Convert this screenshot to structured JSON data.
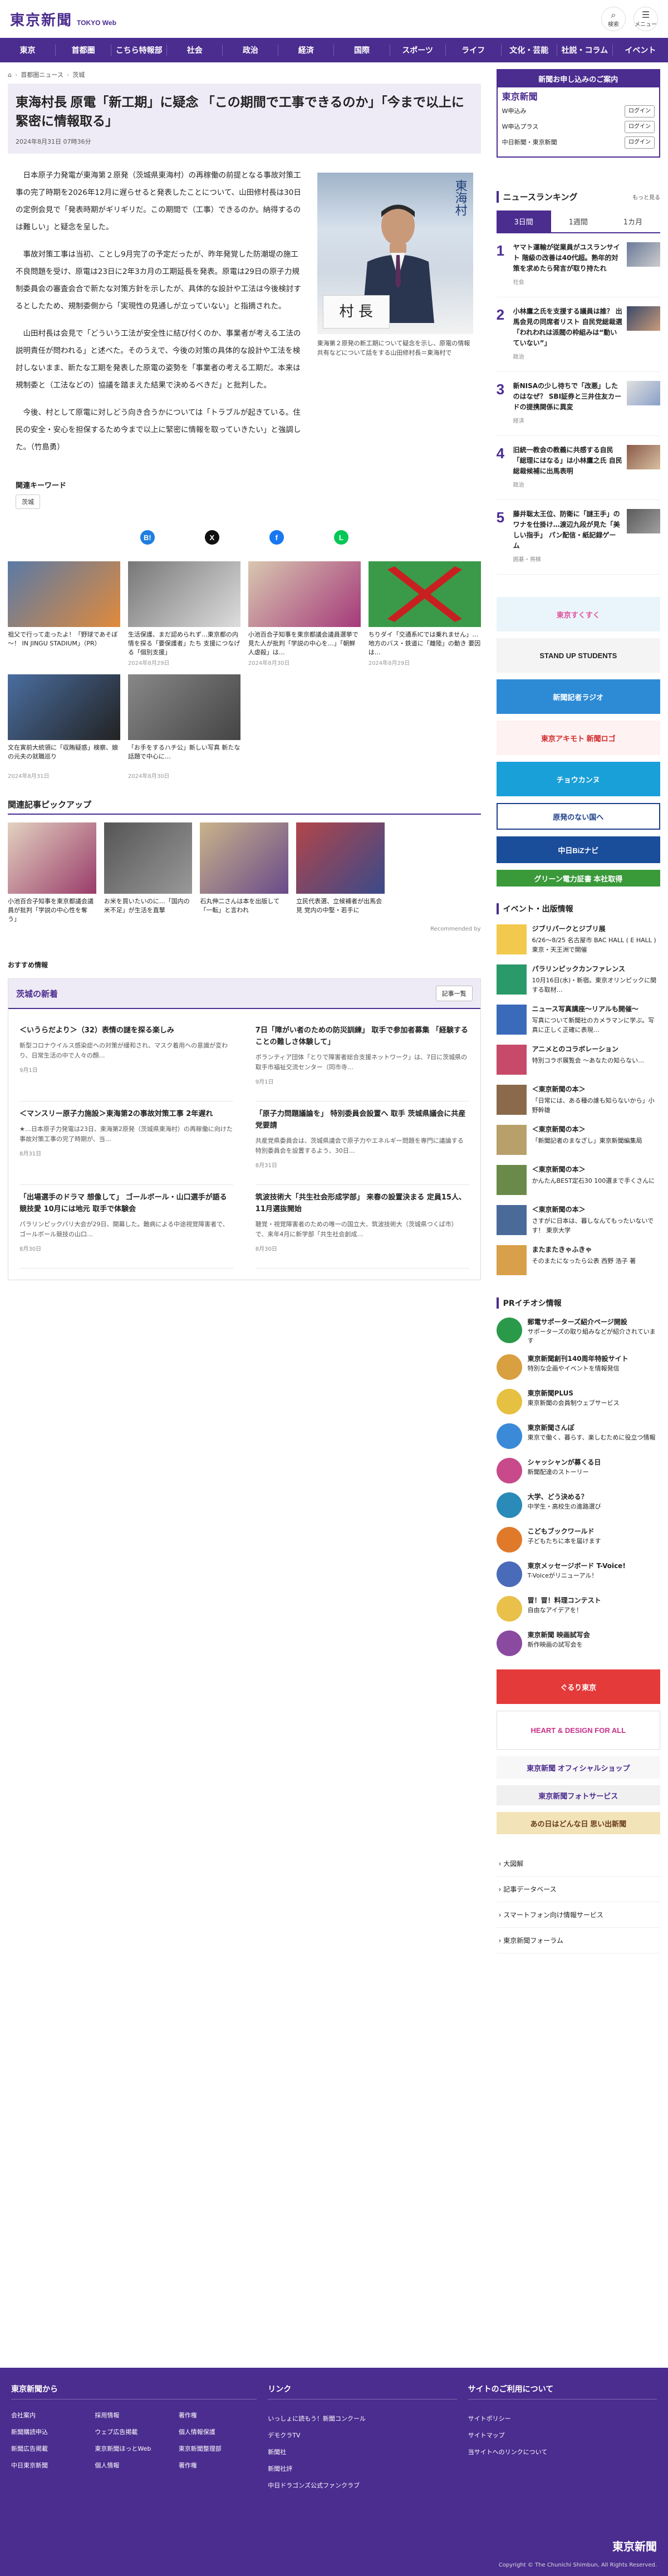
{
  "header": {
    "logo": "東京新聞",
    "logo_sub": "TOKYO Web",
    "icons": [
      {
        "glyph": "⌕",
        "label": "検索"
      },
      {
        "glyph": "☰",
        "label": "メニュー"
      }
    ],
    "nav": [
      "東京",
      "首都圏",
      "こちら特報部",
      "社会",
      "政治",
      "経済",
      "国際",
      "スポーツ",
      "ライフ",
      "文化・芸能",
      "社説・コラム",
      "イベント"
    ]
  },
  "breadcrumb": [
    "ホーム",
    "首都圏ニュース",
    "茨城"
  ],
  "article": {
    "title": "東海村長 原電「新工期」に疑念 「この期間で工事できるのか」「今まで以上に緊密に情報取る」",
    "date": "2024年8月31日 07時36分",
    "paragraphs": [
      "日本原子力発電が東海第２原発（茨城県東海村）の再稼働の前提となる事故対策工事の完了時期を2026年12月に遅らせると発表したことについて、山田修村長は30日の定例会見で「発表時期がギリギリだ。この期間で（工事）できるのか。納得するのは難しい」と疑念を呈した。",
      "事故対策工事は当初、ことし9月完了の予定だったが、昨年発覚した防潮堤の施工不良問題を受け、原電は23日に2年3カ月の工期延長を発表。原電は29日の原子力規制委員会の審査会合で新たな対策方針を示したが、具体的な設計や工法は今後検討するとしたため、規制委側から「実現性の見通しが立っていない」と指摘された。",
      "山田村長は会見で「どういう工法が安全性に結び付くのか、事業者が考える工法の説明責任が問われる」と述べた。そのうえで、今後の対策の具体的な設計や工法を検討しないまま、新たな工期を発表した原電の姿勢を「事業者の考える工期だ。本来は規制委と（工法などの）協議を踏まえた結果で決めるべきだ」と批判した。",
      "今後、村として原電に対しどう向き合うかについては「トラブルが起きている。住民の安全・安心を担保するため今まで以上に緊密に情報を取っていきたい」と強調した。（竹島勇）"
    ],
    "photo_nameplate": "村 長",
    "photo_wall": "東海村",
    "caption": "東海第２原発の新工期について疑念を示し、原電の情報共有などについて話をする山田修村長＝東海村で"
  },
  "keywords": {
    "title": "関連キーワード",
    "tags": [
      "茨城"
    ]
  },
  "share": [
    {
      "label": "B!",
      "color": "#1f7ee0"
    },
    {
      "label": "X",
      "color": "#111111"
    },
    {
      "label": "f",
      "color": "#1877f2"
    },
    {
      "label": "L",
      "color": "#06c755"
    }
  ],
  "related_thumbs": [
    {
      "title": "祖父で行って走ったよ！「野球であそぼ～！ IN JINGU STADIUM」（PR）",
      "date": "",
      "colors": [
        "#5a7aa6",
        "#e08a3c"
      ]
    },
    {
      "title": "生活保護、まだ認められず…東京都の内情を探る「要保護者」たち 支援につなげる「個別支援」",
      "date": "2024年8月29日",
      "colors": [
        "#777777",
        "#dddddd"
      ]
    },
    {
      "title": "小池百合子知事を東京都議会議員選挙で見た人が批判「学説の中心を…」「朝鮮人虐殺」は…",
      "date": "2024年8月30日",
      "colors": [
        "#d8c7b0",
        "#a53a7a"
      ]
    },
    {
      "title": "ちりダイ「交通系ICでは乗れません」…地方のバス・鉄道に「離陸」の動き 要因は…",
      "date": "2024年8月29日",
      "colors": [
        "#3a9a4a",
        "#c82020"
      ]
    },
    {
      "title": "文在寅前大統領に「収賄疑惑」検察、娘の元夫の就職巡り",
      "date": "2024年8月31日",
      "colors": [
        "#4a6ea0",
        "#222222"
      ]
    },
    {
      "title": "「お手をするハチ公」新しい写真 新たな話題で中心に…",
      "date": "2024年8月30日",
      "colors": [
        "#888888",
        "#444444"
      ]
    }
  ],
  "pickup": {
    "title": "関連記事ピックアップ",
    "items": [
      {
        "title": "小池百合子知事を東京都議会議員が批判「学説の中心性を奪う」",
        "colors": [
          "#e2d2c0",
          "#9a3c6a"
        ]
      },
      {
        "title": "お米を買いたいのに…「国内の米不足」が生活を直撃",
        "colors": [
          "#555555",
          "#999999"
        ]
      },
      {
        "title": "石丸伸二さんは本を出版して「一転」と言われ",
        "colors": [
          "#c9b38a",
          "#6a4a8a"
        ]
      },
      {
        "title": "立民代表選、立候補者が出馬会見 党内の中堅・若手に",
        "colors": [
          "#b2454a",
          "#3a4a8a"
        ]
      },
      {
        "title": "",
        "colors": [
          "#ffffff",
          "#ffffff"
        ]
      }
    ],
    "recommend": "Recommended by"
  },
  "osusume": "おすすめ情報",
  "local": {
    "name": "茨城の新着",
    "more": "記事一覧",
    "items": [
      {
        "title": "＜いうらだより＞（32）表情の謎を探る楽しみ",
        "summary": "新型コロナウイルス感染症への対策が緩和され、マスク着用への意識が変わり、日常生活の中で人々の顔…",
        "date": "9月1日"
      },
      {
        "title": "7日「障がい者のための防災訓練」 取手で参加者募集 「経験することの難しさ体験して」",
        "summary": "ボランティア団体「とりで障害者総合支援ネットワーク」は、7日に茨城県の取手市福祉交流センター（同市寺…",
        "date": "9月1日"
      },
      {
        "title": "＜マンスリー原子力施設＞東海第2の事故対策工事 2年遅れ",
        "summary": "★…日本原子力発電は23日、東海第2原発（茨城県東海村）の再稼働に向けた事故対策工事の完了時期が、当…",
        "date": "8月31日"
      },
      {
        "title": "「原子力問題議論を」 特別委員会設置へ 取手 茨城県議会に共産党要請",
        "summary": "共産党県委員会は、茨城県議会で原子力やエネルギー問題を専門に議論する特別委員会を設置するよう、30日…",
        "date": "8月31日"
      },
      {
        "title": "「出場選手のドラマ 想像して」 ゴールボール・山口選手が語る競技愛 10月には地元 取手で体験会",
        "summary": "パラリンピックパリ大会が29日、開幕した。難病による中途視覚障害者で、ゴールボール競技の山口…",
        "date": "8月30日"
      },
      {
        "title": "筑波技術大「共生社会形成学部」 来春の設置決まる 定員15人、11月選抜開始",
        "summary": "聴覚・視覚障害者のための唯一の国立大、筑波技術大（茨城県つくば市）で、来年4月に新学部「共生社会創成…",
        "date": "8月30日"
      }
    ]
  },
  "sidebar": {
    "promo": {
      "head": "新聞お申し込みのご案内",
      "logo": "東京新聞",
      "rows": [
        "W申込み",
        "W申込プラス",
        "中日新聞・東京新聞"
      ],
      "btn": "ログイン"
    },
    "ranking": {
      "title": "ニュースランキング",
      "more": "もっと見る",
      "tabs": [
        "3日間",
        "1週間",
        "1カ月"
      ],
      "items": [
        {
          "no": "1",
          "text": "ヤマト運輸が従業員がユスランサイト 階級の改善は40代超。熟年的対策を求めたら発言が取り持たれ",
          "cat": "社会"
        },
        {
          "no": "2",
          "text": "小林鷹之氏を支援する議員は誰？ 出馬会見の同席者リスト 自民党総裁選 「われわれは派閥の枠組みは“動いていない”」",
          "cat": "政治"
        },
        {
          "no": "3",
          "text": "新NISAの少し待ちで「改悪」したのはなぜ？ SBI証券と三井住友カードの提携関係に異変",
          "cat": "経済"
        },
        {
          "no": "4",
          "text": "旧統一教会の教義に共感する自民「総理にはなる」は小林鷹之氏 自民総裁候補に出馬表明",
          "cat": "政治"
        },
        {
          "no": "5",
          "text": "藤井聡太王位、防衛に「謎王手」のワナを仕掛け…渡辺九段が見た「美しい指手」 パン配信・紙記録ゲーム",
          "cat": "囲碁・将棋"
        }
      ]
    },
    "banners": [
      {
        "text": "東京すくすく",
        "bg": "#eaf5fb",
        "fg": "#e0509a"
      },
      {
        "text": "STAND UP STUDENTS",
        "bg": "#f4f4f4",
        "fg": "#222222"
      },
      {
        "text": "新聞記者ラジオ",
        "bg": "#2d8bd6",
        "fg": "#ffffff"
      },
      {
        "text": "東京アキモト 新聞ロゴ",
        "bg": "#fff2f2",
        "fg": "#d22a2a"
      },
      {
        "text": "チョウカンヌ",
        "bg": "#1aa0d8",
        "fg": "#ffffff"
      },
      {
        "text": "原発のない国へ",
        "bg": "#ffffff",
        "fg": "#1d3d8a"
      },
      {
        "text": "中日BiZナビ",
        "bg": "#1a4d9a",
        "fg": "#ffffff"
      },
      {
        "text": "グリーン電力証書 本社取得",
        "bg": "#3a9a3a",
        "fg": "#ffffff"
      }
    ],
    "events_title": "イベント・出版情報",
    "events": [
      {
        "title": "ジブリパークとジブリ展",
        "desc": "6/26〜8/25 名古屋市 BAC HALL ( E HALL )東京・天王洲で開催",
        "color": "#f2c94c"
      },
      {
        "title": "パラリンピックカンファレンス",
        "desc": "10月16日(水)・新宿。東京オリンピックに関する取材…",
        "color": "#2a9a6a"
      },
      {
        "title": "ニュース写真講座～リアルも開催～",
        "desc": "写真について新聞社のカメラマンに学ぶ。写真に正しく正確に表現…",
        "color": "#3a6aba"
      },
      {
        "title": "アニメとのコラボレーション",
        "desc": "特別コラボ展覧会 ～あなたの知らない…",
        "color": "#c84a6a"
      },
      {
        "title": "＜東京新聞の本＞",
        "desc": "「日常には、ある種の誰も知らないから」小野幹雄",
        "color": "#8a6a4a"
      },
      {
        "title": "＜東京新聞の本＞",
        "desc": "「新聞記者のまなざし」東京新聞編集局",
        "color": "#b8a06a"
      },
      {
        "title": "＜東京新聞の本＞",
        "desc": "かんたんBEST定石30 100選まで手くさんに",
        "color": "#6a8a4a"
      },
      {
        "title": "＜東京新聞の本＞",
        "desc": "さすがに日本は、暮しなんてもったいないです！ 東京大学",
        "color": "#4a6a9a"
      },
      {
        "title": "またまたきゃふきゃ",
        "desc": "そのまたになったら公表 西野 浩子 著",
        "color": "#d8a04a"
      }
    ],
    "pr_title": "PRイチオシ情報",
    "pr": [
      {
        "title": "郵電サポーターズ紹介ページ開設",
        "desc": "サポーターズの取り組みなどが紹介されています",
        "color": "#2a9a4a"
      },
      {
        "title": "東京新聞創刊140周年特設サイト",
        "desc": "特別な企画やイベントを情報発信",
        "color": "#d8a040"
      },
      {
        "title": "東京新聞PLUS",
        "desc": "東京新聞の会員制ウェブサービス",
        "color": "#e6c040"
      },
      {
        "title": "東京新聞さんぽ",
        "desc": "東京で働く、暮らす、楽しむために役立つ情報",
        "color": "#3a8ad8"
      },
      {
        "title": "シャッシャンが募くる日",
        "desc": "新聞配達のストーリー",
        "color": "#c84a8a"
      },
      {
        "title": "大学、どう決める？",
        "desc": "中学生・高校生の進路選び",
        "color": "#2a8ab8"
      },
      {
        "title": "こどもブックワールド",
        "desc": "子どもたちに本を届けます",
        "color": "#e07a2a"
      },
      {
        "title": "東京メッセージボード T-Voice!",
        "desc": "T-Voiceがリニューアル！",
        "color": "#4a6aba"
      },
      {
        "title": "冒！冒！料理コンテスト",
        "desc": "自由なアイデアを！",
        "color": "#e8c04a"
      },
      {
        "title": "東京新聞 映画試写会",
        "desc": "新作映画の試写会を",
        "color": "#8a4aa0"
      }
    ],
    "banners2": [
      {
        "text": "ぐるり東京",
        "bg": "#e43a3a",
        "fg": "#ffffff"
      },
      {
        "text": "HEART & DESIGN FOR ALL",
        "bg": "#ffffff",
        "fg": "#c8308a"
      },
      {
        "text": "東京新聞 オフィシャルショップ",
        "bg": "#f7f7f7",
        "fg": "#4b2c8f"
      },
      {
        "text": "東京新聞フォトサービス",
        "bg": "#f0f0f0",
        "fg": "#4b2c8f"
      },
      {
        "text": "あの日はどんな日 思い出新聞",
        "bg": "#f2e4b8",
        "fg": "#6a3a1a"
      }
    ],
    "links": [
      "大図解",
      "記事データベース",
      "スマートフォン向け情報サービス",
      "東京新聞フォーラム"
    ]
  },
  "footer": {
    "col1_title": "東京新聞から",
    "col1": [
      "会社案内",
      "採用情報",
      "著作権",
      "新聞購読申込",
      "ウェブ広告掲載",
      "個人情報保護",
      "新聞広告掲載",
      "東京新聞ほっとWeb",
      "東京新聞整理部",
      "中日東京新聞",
      "個人情報",
      "著作権"
    ],
    "col2_title": "リンク",
    "col2": [
      "いっしょに読もう！新聞コンクール",
      "デモクラTV",
      "新聞社",
      "新聞社評",
      "中日ドラゴンズ公式ファンクラブ"
    ],
    "col3_title": "サイトのご利用について",
    "col3": [
      "サイトポリシー",
      "サイトマップ",
      "当サイトへのリンクについて"
    ],
    "logo": "東京新聞",
    "copyright": "Copyright © The Chunichi Shimbun, All Rights Reserved."
  }
}
